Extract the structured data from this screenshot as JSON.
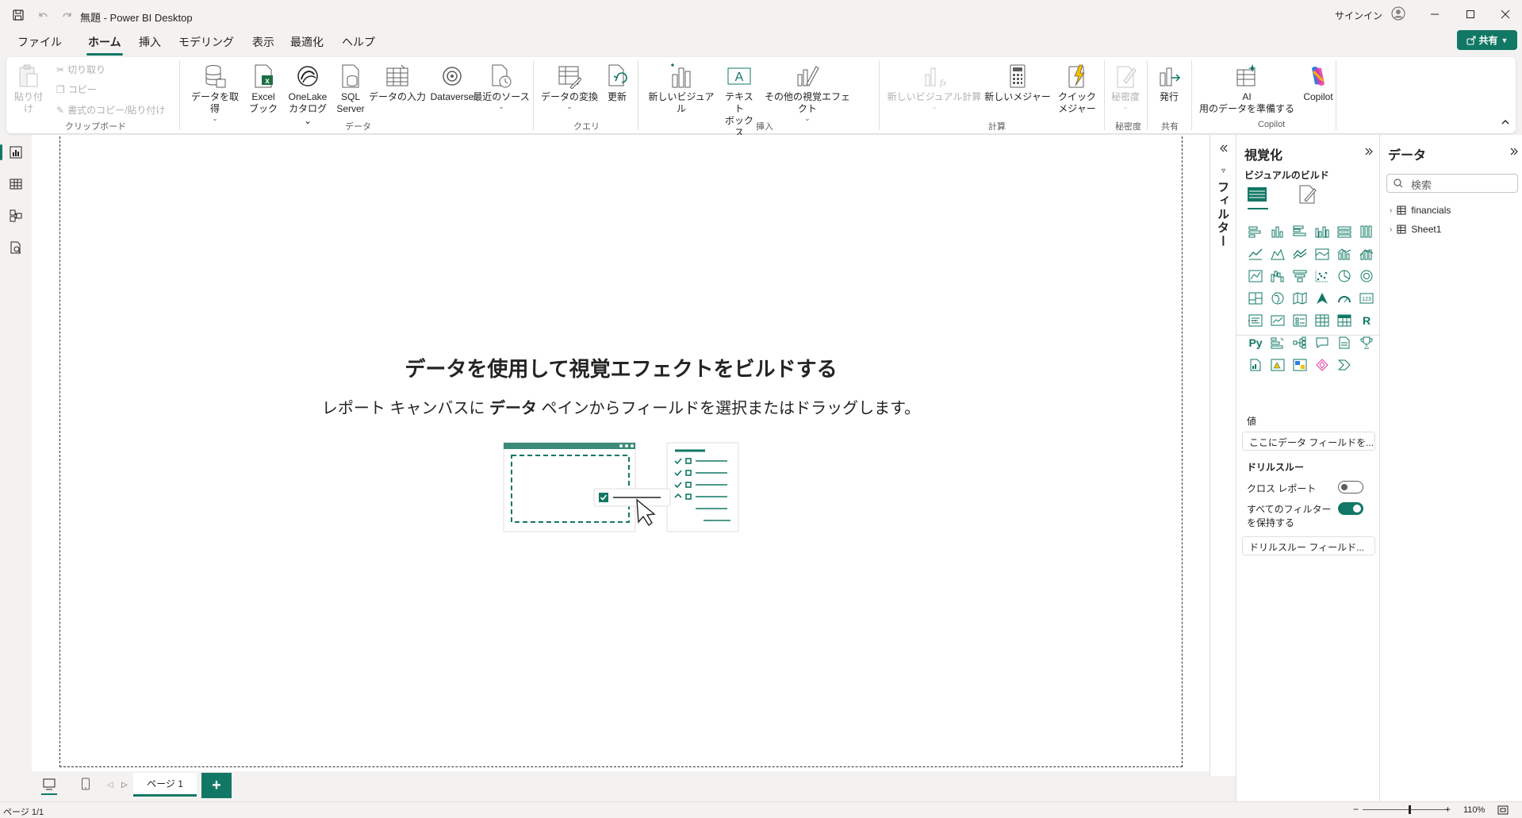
{
  "window": {
    "title": "無題 - Power BI Desktop",
    "signin_label": "サインイン"
  },
  "menu": {
    "tabs": [
      "ファイル",
      "ホーム",
      "挿入",
      "モデリング",
      "表示",
      "最適化",
      "ヘルプ"
    ],
    "active_tab": "ホーム",
    "share_label": "共有"
  },
  "ribbon": {
    "clipboard": {
      "paste": "貼り付け",
      "cut": "切り取り",
      "copy": "コピー",
      "format_painter": "書式のコピー/貼り付け",
      "group": "クリップボード"
    },
    "data": {
      "get_data": "データを取得",
      "excel_1": "Excel",
      "excel_2": "ブック",
      "onelake_1": "OneLake",
      "onelake_2": "カタログ",
      "sql_1": "SQL",
      "sql_2": "Server",
      "enter_data": "データの入力",
      "dataverse": "Dataverse",
      "recent": "最近のソース",
      "group": "データ"
    },
    "query": {
      "transform": "データの変換",
      "refresh": "更新",
      "group": "クエリ"
    },
    "insert": {
      "new_visual": "新しいビジュアル",
      "textbox_1": "テキスト",
      "textbox_2": "ボックス",
      "more_visuals": "その他の視覚エフェクト",
      "group": "挿入"
    },
    "calc": {
      "new_visual_calc": "新しいビジュアル計算",
      "new_measure": "新しいメジャー",
      "quick_1": "クイック",
      "quick_2": "メジャー",
      "group": "計算"
    },
    "sensitivity": {
      "label": "秘密度",
      "group": "秘密度"
    },
    "share": {
      "publish": "発行",
      "group": "共有"
    },
    "copilot": {
      "ai_1": "AI",
      "ai_2": "用のデータを準備する",
      "copilot": "Copilot",
      "group": "Copilot"
    }
  },
  "canvas": {
    "empty_title": "データを使用して視覚エフェクトをビルドする",
    "empty_sub_pre": "レポート キャンバスに ",
    "empty_sub_bold": "データ",
    "empty_sub_post": " ペインからフィールドを選択またはドラッグします。"
  },
  "pages": {
    "tabs": [
      "ページ 1"
    ],
    "add_label": "+"
  },
  "status": {
    "page_indicator": "ページ 1/1",
    "zoom": "110%",
    "zoom_level": 0.55
  },
  "filters": {
    "label": "フィルター"
  },
  "visualizations": {
    "title": "視覚化",
    "build_label": "ビジュアルのビルド",
    "more": "...",
    "values_label": "値",
    "values_placeholder": "ここにデータ フィールドを...",
    "drillthrough_label": "ドリルスルー",
    "cross_report_label": "クロス レポート",
    "cross_report_on": false,
    "keep_filters_label_1": "すべてのフィルター",
    "keep_filters_label_2": "を保持する",
    "keep_filters_on": true,
    "drill_fields_placeholder": "ドリルスルー フィールド..."
  },
  "data_pane": {
    "title": "データ",
    "search_placeholder": "検索",
    "tables": [
      "financials",
      "Sheet1"
    ]
  },
  "colors": {
    "accent": "#117865",
    "background": "#f3f2f1"
  }
}
